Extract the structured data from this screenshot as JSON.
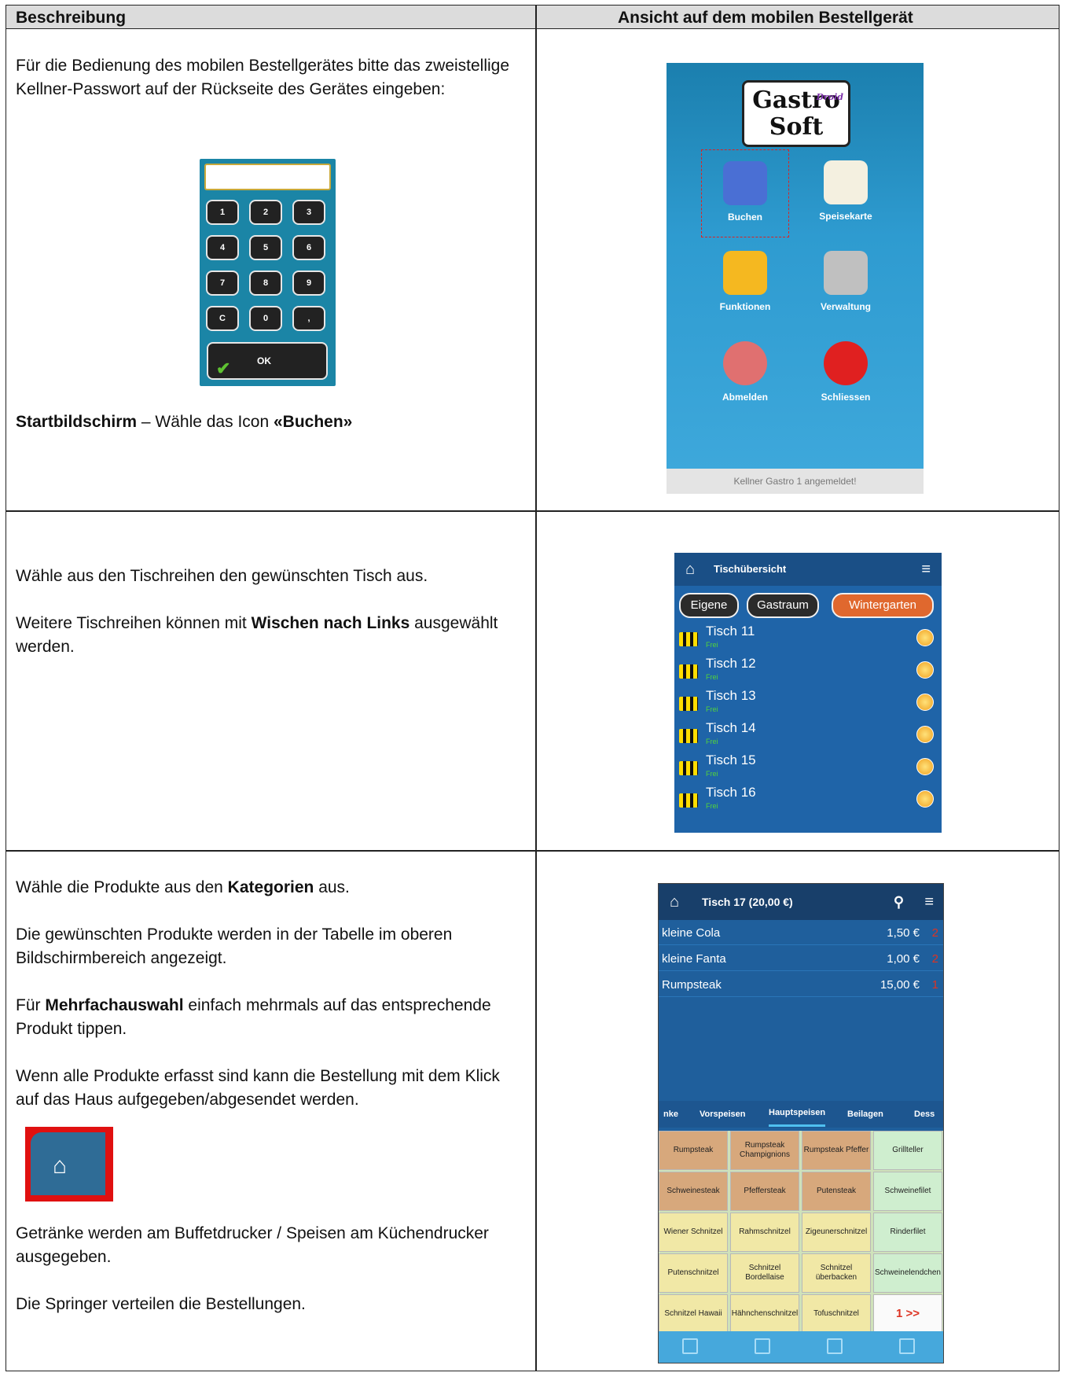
{
  "header": {
    "col1": "Beschreibung",
    "col2": "Ansicht auf dem mobilen Bestellgerät"
  },
  "row1": {
    "para1": "Für die Bedienung des mobilen Bestellgerätes bitte das zweistellige Kellner-Passwort auf der Rückseite des Gerätes eingeben:",
    "keys": [
      "1",
      "2",
      "3",
      "4",
      "5",
      "6",
      "7",
      "8",
      "9",
      "C",
      "0",
      ","
    ],
    "ok": "OK",
    "start_bold": "Startbildschirm",
    "start_mid": " – Wähle das Icon ",
    "start_icon": "«Buchen»",
    "logo_top": "Gastro",
    "logo_bottom": "Soft",
    "logo_tag": "Droid",
    "tiles": [
      "Buchen",
      "Speisekarte",
      "Funktionen",
      "Verwaltung",
      "Abmelden",
      "Schliessen"
    ],
    "status": "Kellner Gastro 1 angemeldet!"
  },
  "row2": {
    "para1": "Wähle aus den Tischreihen den gewünschten Tisch aus.",
    "para2_a": "Weitere Tischreihen können mit ",
    "para2_b": "Wischen nach Links",
    "para2_c": " ausgewählt werden.",
    "bar": "Tischübersicht",
    "pills": [
      "Eigene",
      "Gastraum",
      "Wintergarten"
    ],
    "tables": [
      "Tisch 11",
      "Tisch 12",
      "Tisch 13",
      "Tisch 14",
      "Tisch 15",
      "Tisch 16"
    ],
    "free": "Frei"
  },
  "row3": {
    "p1_a": "Wähle die Produkte aus den ",
    "p1_b": "Kategorien",
    "p1_c": " aus.",
    "p2": "Die gewünschten Produkte werden in der Tabelle im oberen Bildschirmbereich angezeigt.",
    "p3_a": "Für ",
    "p3_b": "Mehrfachauswahl",
    "p3_c": " einfach mehrmals auf das entsprechende Produkt tippen.",
    "p4": "Wenn alle Produkte erfasst sind kann die Bestellung mit dem Klick auf das Haus aufgegeben/abgesendet werden.",
    "p5": "Getränke werden am Buffetdrucker / Speisen am Küchendrucker ausgegeben.",
    "p6": "Die Springer verteilen die Bestellungen.",
    "bar": "Tisch 17 (20,00 €)",
    "orders": [
      {
        "n": "kleine Cola",
        "p": "1,50 €",
        "q": "2"
      },
      {
        "n": "kleine Fanta",
        "p": "1,00 €",
        "q": "2"
      },
      {
        "n": "Rumpsteak",
        "p": "15,00 €",
        "q": "1"
      }
    ],
    "tabs": [
      "nke",
      "Vorspeisen",
      "Hauptspeisen",
      "Beilagen",
      "Dess"
    ],
    "products": [
      "Rumpsteak",
      "Rumpsteak Champignions",
      "Rumpsteak Pfeffer",
      "Grillteller",
      "Schweinesteak",
      "Pfeffersteak",
      "Putensteak",
      "Schweinefilet",
      "Wiener Schnitzel",
      "Rahmschnitzel",
      "Zigeunerschnitzel",
      "Rinderfilet",
      "Putenschnitzel",
      "Schnitzel Bordellaise",
      "Schnitzel überbacken",
      "Schweinelendchen",
      "Schnitzel Hawaii",
      "Hähnchenschnitzel",
      "Tofuschnitzel",
      "1 >>"
    ]
  }
}
